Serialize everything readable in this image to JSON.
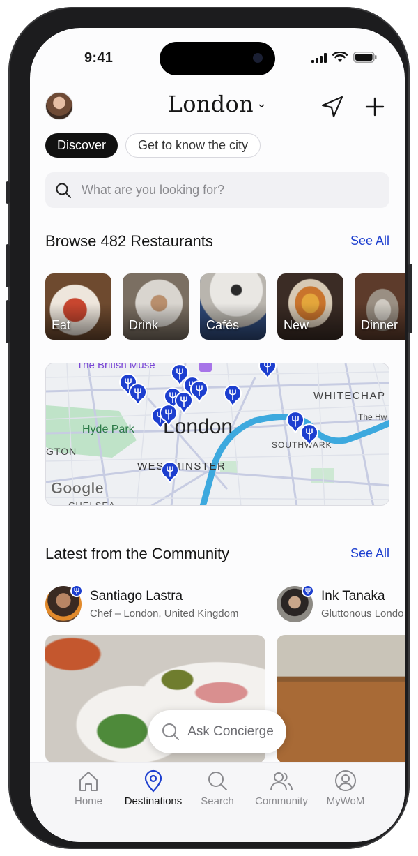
{
  "status": {
    "time": "9:41"
  },
  "header": {
    "city": "London",
    "city_chevron": "⌄"
  },
  "pills": {
    "active": "Discover",
    "inactive": "Get to know the city"
  },
  "search": {
    "placeholder": "What are you looking for?"
  },
  "browse": {
    "title": "Browse 482 Restaurants",
    "see_all": "See All"
  },
  "categories": [
    {
      "label": "Eat"
    },
    {
      "label": "Drink"
    },
    {
      "label": "Cafés"
    },
    {
      "label": "New"
    },
    {
      "label": "Dinner"
    }
  ],
  "map": {
    "city_label": "London",
    "labels": {
      "british_museum": "The British Muse",
      "whitechapel": "WHITECHAP",
      "the_hw": "The Hw",
      "hyde_park": "Hyde Park",
      "southwark": "SOUTHWARK",
      "kensington": "GTON",
      "westminster": "WESTMINSTER",
      "chelsea": "CHELSEA",
      "google": "Google"
    }
  },
  "community": {
    "title": "Latest from the Community",
    "see_all": "See All",
    "posts": [
      {
        "name": "Santiago Lastra",
        "subtitle": "Chef – London, United Kingdom"
      },
      {
        "name": "Ink Tanaka",
        "subtitle": "Gluttonous Londo"
      }
    ]
  },
  "concierge": {
    "label": "Ask Concierge"
  },
  "tabs": [
    {
      "label": "Home",
      "icon": "home-icon"
    },
    {
      "label": "Destinations",
      "icon": "location-pin-icon"
    },
    {
      "label": "Search",
      "icon": "search-icon"
    },
    {
      "label": "Community",
      "icon": "people-icon"
    },
    {
      "label": "MyWoM",
      "icon": "profile-icon"
    }
  ],
  "colors": {
    "accent": "#1d3fcf",
    "pin": "#1d3fcf",
    "river": "#3da9de",
    "park": "#bfe3c8"
  }
}
